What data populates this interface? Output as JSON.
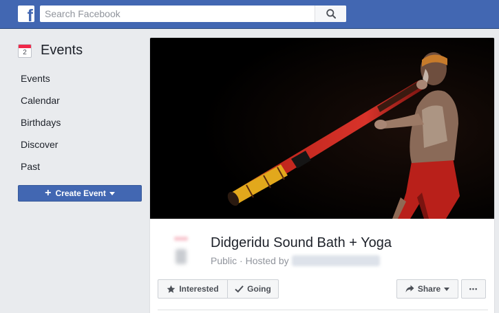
{
  "topbar": {
    "logo_letter": "f",
    "search": {
      "placeholder": "Search Facebook",
      "value": ""
    }
  },
  "sidebar": {
    "title": "Events",
    "calendar_icon_day": "2",
    "items": [
      {
        "label": "Events"
      },
      {
        "label": "Calendar"
      },
      {
        "label": "Birthdays"
      },
      {
        "label": "Discover"
      },
      {
        "label": "Past"
      }
    ],
    "create_button": {
      "icon": "+",
      "label": "Create Event"
    }
  },
  "event": {
    "cover_image": "didgeridoo-player-photo",
    "title": "Didgeridu Sound Bath + Yoga",
    "privacy": "Public",
    "separator": "·",
    "hosted_by_label": "Hosted by",
    "actions": {
      "interested": "Interested",
      "going": "Going",
      "share": "Share",
      "more": "•••"
    }
  },
  "colors": {
    "brand": "#4267b2",
    "background": "#e9ebee",
    "calendar_red": "#f02849"
  }
}
